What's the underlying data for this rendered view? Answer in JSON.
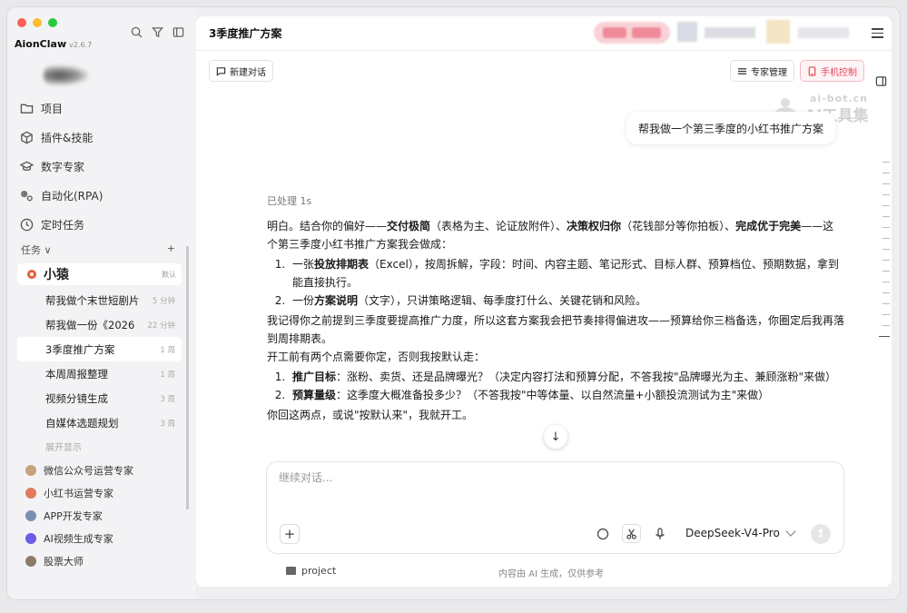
{
  "app": {
    "name": "AionClaw",
    "version": "v2.6.7"
  },
  "sidebar": {
    "nav": [
      {
        "label": "项目",
        "icon": "folder-icon"
      },
      {
        "label": "插件&技能",
        "icon": "cube-icon"
      },
      {
        "label": "数字专家",
        "icon": "graduation-cap-icon"
      },
      {
        "label": "自动化(RPA)",
        "icon": "automation-icon"
      },
      {
        "label": "定时任务",
        "icon": "clock-icon"
      }
    ],
    "tasks_label": "任务",
    "tasks_add": "+",
    "group": {
      "name": "小猿",
      "tag": "默认"
    },
    "tasks": [
      {
        "title": "帮我做个末世短剧片",
        "time": "5 分钟"
      },
      {
        "title": "帮我做一份《2026",
        "time": "22 分钟"
      },
      {
        "title": "3季度推广方案",
        "time": "1 周"
      },
      {
        "title": "本周周报整理",
        "time": "1 周"
      },
      {
        "title": "视频分镜生成",
        "time": "3 周"
      },
      {
        "title": "自媒体选题规划",
        "time": "3 周"
      }
    ],
    "show_more": "展开显示",
    "experts": [
      {
        "name": "微信公众号运营专家",
        "color": "#c8a27a"
      },
      {
        "name": "小红书运营专家",
        "color": "#e07a5f"
      },
      {
        "name": "APP开发专家",
        "color": "#7a8fb5"
      },
      {
        "name": "AI视频生成专家",
        "color": "#6c5ce7"
      },
      {
        "name": "股票大师",
        "color": "#8d7b6a"
      }
    ]
  },
  "header": {
    "title": "3季度推广方案"
  },
  "toolbar": {
    "new_chat": "新建对话",
    "expert_manage": "专家管理",
    "phone_control": "手机控制"
  },
  "watermark": {
    "top": "ai-bot.cn",
    "bottom": "AI工具集"
  },
  "chat": {
    "user_message": "帮我做一个第三季度的小红书推广方案",
    "processed": "已处理 1s",
    "intro_1": "明白。结合你的偏好——",
    "intro_b1": "交付极简",
    "intro_2": "（表格为主、论证放附件）、",
    "intro_b2": "决策权归你",
    "intro_3": "（花钱部分等你拍板）、",
    "intro_b3": "完成优于完美",
    "intro_4": "——这个第三季度小红书推广方案我会做成：",
    "deliverables": [
      {
        "pre": "一张",
        "bold": "投放排期表",
        "post": "（Excel），按周拆解，字段：时间、内容主题、笔记形式、目标人群、预算档位、预期数据，拿到能直接执行。"
      },
      {
        "pre": "一份",
        "bold": "方案说明",
        "post": "（文字），只讲策略逻辑、每季度打什么、关键花销和风险。"
      }
    ],
    "memory_note": "我记得你之前提到三季度要提高推广力度，所以这套方案我会把节奏排得偏进攻——预算给你三档备选，你圈定后我再落到周排期表。",
    "confirm_lead": "开工前有两个点需要你定，否则我按默认走：",
    "questions": [
      {
        "bold": "推广目标",
        "post": "：涨粉、卖货、还是品牌曝光？（决定内容打法和预算分配，不答我按\"品牌曝光为主、兼顾涨粉\"来做）"
      },
      {
        "bold": "预算量级",
        "post": "：这季度大概准备投多少？（不答我按\"中等体量、以自然流量+小额投流测试为主\"来做）"
      }
    ],
    "closing": "你回这两点，或说\"按默认来\"，我就开工。"
  },
  "composer": {
    "placeholder": "继续对话...",
    "model": "DeepSeek-V4-Pro"
  },
  "footer": {
    "folder": "project",
    "note": "内容由 AI 生成，仅供参考"
  },
  "colors": {
    "accent_red": "#e0475b",
    "sidebar_bg": "#f3f3f5",
    "group_dot": "#e85c3a"
  }
}
